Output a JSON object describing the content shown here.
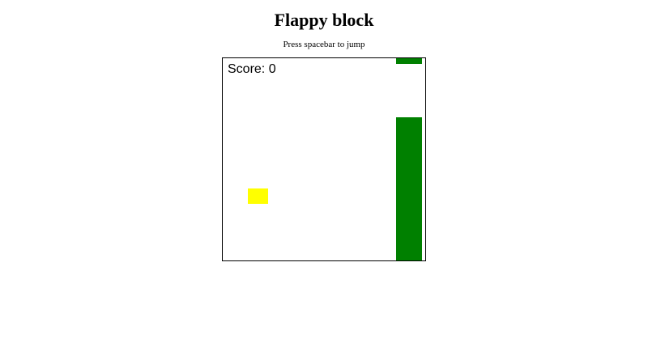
{
  "page": {
    "title": "Flappy block",
    "instructions": "Press spacebar to jump"
  },
  "game": {
    "score_label": "Score: 0",
    "score": 0,
    "colors": {
      "background": "#ffffff",
      "border": "#000000",
      "pipe": "#008000",
      "player": "#ffff00"
    }
  }
}
